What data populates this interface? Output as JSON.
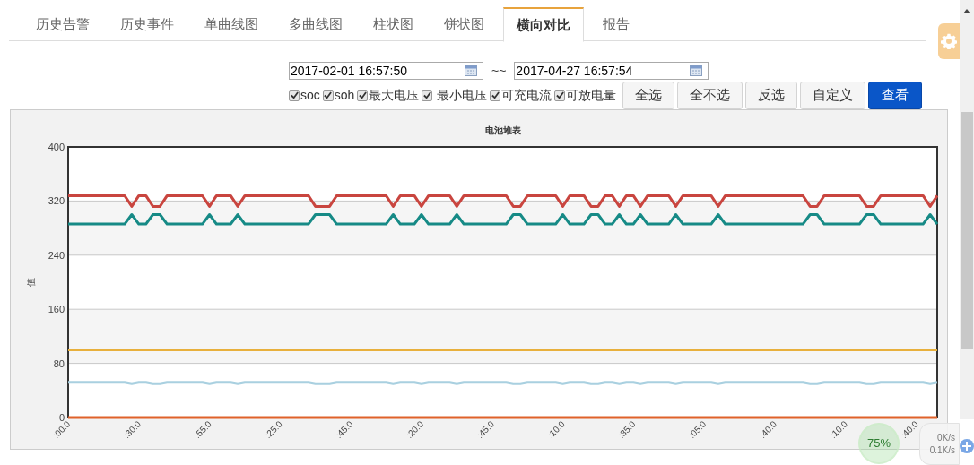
{
  "tabs": [
    {
      "label": "历史告警",
      "selected": false
    },
    {
      "label": "历史事件",
      "selected": false
    },
    {
      "label": "单曲线图",
      "selected": false
    },
    {
      "label": "多曲线图",
      "selected": false
    },
    {
      "label": "柱状图",
      "selected": false
    },
    {
      "label": "饼状图",
      "selected": false
    },
    {
      "label": "横向对比",
      "selected": true
    },
    {
      "label": "报告",
      "selected": false
    }
  ],
  "date_range": {
    "start": "2017-02-01 16:57:50",
    "separator": "~~",
    "end": "2017-04-27 16:57:54"
  },
  "filters": [
    {
      "label": "soc",
      "checked": true
    },
    {
      "label": "soh",
      "checked": true
    },
    {
      "label": "最大电压",
      "checked": true
    },
    {
      "label": "最小电压",
      "checked": true
    },
    {
      "label": "可充电流",
      "checked": true
    },
    {
      "label": "可放电量",
      "checked": true
    }
  ],
  "buttons": [
    {
      "label": "全选",
      "kind": "default"
    },
    {
      "label": "全不选",
      "kind": "default"
    },
    {
      "label": "反选",
      "kind": "default"
    },
    {
      "label": "自定义",
      "kind": "default"
    },
    {
      "label": "查看",
      "kind": "primary"
    }
  ],
  "chart": {
    "chart_data": {
      "type": "line",
      "title": "电池堆表",
      "ylabel": "值",
      "categories": [
        ":00:0",
        null,
        null,
        null,
        null,
        null,
        null,
        null,
        null,
        null,
        ":30:0",
        null,
        null,
        null,
        null,
        null,
        null,
        null,
        null,
        null,
        ":55:0",
        null,
        null,
        null,
        null,
        null,
        null,
        null,
        null,
        null,
        ":25:0",
        null,
        null,
        null,
        null,
        null,
        null,
        null,
        null,
        null,
        ":45:0",
        null,
        null,
        null,
        null,
        null,
        null,
        null,
        null,
        null,
        ":20:0",
        null,
        null,
        null,
        null,
        null,
        null,
        null,
        null,
        null,
        ":45:0",
        null,
        null,
        null,
        null,
        null,
        null,
        null,
        null,
        null,
        ":10:0",
        null,
        null,
        null,
        null,
        null,
        null,
        null,
        null,
        null,
        ":35:0",
        null,
        null,
        null,
        null,
        null,
        null,
        null,
        null,
        null,
        ":05:0",
        null,
        null,
        null,
        null,
        null,
        null,
        null,
        null,
        null,
        ":40:0",
        null,
        null,
        null,
        null,
        null,
        null,
        null,
        null,
        null,
        ":10:0",
        null,
        null,
        null,
        null,
        null,
        null,
        null,
        null,
        null,
        ":40:0",
        null,
        null,
        null
      ],
      "series": [
        {
          "color": "#c9453f",
          "values": [
            328,
            328,
            328,
            328,
            328,
            328,
            328,
            328,
            328,
            312,
            328,
            328,
            312,
            312,
            328,
            328,
            328,
            328,
            328,
            328,
            312,
            328,
            328,
            328,
            312,
            328,
            328,
            328,
            328,
            328,
            328,
            328,
            328,
            328,
            328,
            312,
            312,
            312,
            328,
            328,
            328,
            328,
            328,
            328,
            328,
            328,
            312,
            328,
            328,
            328,
            312,
            328,
            328,
            328,
            328,
            312,
            328,
            328,
            328,
            328,
            328,
            328,
            328,
            312,
            312,
            328,
            328,
            328,
            328,
            328,
            312,
            328,
            328,
            328,
            312,
            312,
            328,
            328,
            312,
            328,
            328,
            312,
            328,
            328,
            328,
            328,
            312,
            328,
            328,
            328,
            328,
            328,
            312,
            328,
            328,
            328,
            328,
            328,
            328,
            328,
            328,
            328,
            328,
            328,
            328,
            312,
            312,
            328,
            328,
            328,
            328,
            328,
            328,
            312,
            312,
            328,
            328,
            328,
            328,
            328,
            328,
            328,
            312,
            328
          ]
        },
        {
          "color": "#168a86",
          "values": [
            286,
            286,
            286,
            286,
            286,
            286,
            286,
            286,
            286,
            300,
            286,
            286,
            300,
            300,
            286,
            286,
            286,
            286,
            286,
            286,
            300,
            286,
            286,
            286,
            300,
            286,
            286,
            286,
            286,
            286,
            286,
            286,
            286,
            286,
            286,
            300,
            300,
            300,
            286,
            286,
            286,
            286,
            286,
            286,
            286,
            286,
            300,
            286,
            286,
            286,
            300,
            286,
            286,
            286,
            286,
            300,
            286,
            286,
            286,
            286,
            286,
            286,
            286,
            300,
            300,
            286,
            286,
            286,
            286,
            286,
            300,
            286,
            286,
            286,
            300,
            300,
            286,
            286,
            300,
            286,
            286,
            300,
            286,
            286,
            286,
            286,
            300,
            286,
            286,
            286,
            286,
            286,
            300,
            286,
            286,
            286,
            286,
            286,
            286,
            286,
            286,
            286,
            286,
            286,
            286,
            300,
            300,
            286,
            286,
            286,
            286,
            286,
            286,
            300,
            300,
            286,
            286,
            286,
            286,
            286,
            286,
            286,
            300,
            286
          ]
        },
        {
          "color": "#e8b03c",
          "values": [
            100,
            100,
            100,
            100,
            100,
            100,
            100,
            100,
            100,
            100,
            100,
            100,
            100,
            100,
            100,
            100,
            100,
            100,
            100,
            100,
            100,
            100,
            100,
            100,
            100,
            100,
            100,
            100,
            100,
            100,
            100,
            100,
            100,
            100,
            100,
            100,
            100,
            100,
            100,
            100,
            100,
            100,
            100,
            100,
            100,
            100,
            100,
            100,
            100,
            100,
            100,
            100,
            100,
            100,
            100,
            100,
            100,
            100,
            100,
            100,
            100,
            100,
            100,
            100,
            100,
            100,
            100,
            100,
            100,
            100,
            100,
            100,
            100,
            100,
            100,
            100,
            100,
            100,
            100,
            100,
            100,
            100,
            100,
            100,
            100,
            100,
            100,
            100,
            100,
            100,
            100,
            100,
            100,
            100,
            100,
            100,
            100,
            100,
            100,
            100,
            100,
            100,
            100,
            100,
            100,
            100,
            100,
            100,
            100,
            100,
            100,
            100,
            100,
            100,
            100,
            100,
            100,
            100,
            100,
            100,
            100,
            100,
            100,
            100
          ]
        },
        {
          "color": "#a9d0e0",
          "values": [
            52,
            52,
            52,
            52,
            52,
            52,
            52,
            52,
            52,
            50,
            52,
            52,
            50,
            50,
            52,
            52,
            52,
            52,
            52,
            52,
            50,
            52,
            52,
            52,
            50,
            52,
            52,
            52,
            52,
            52,
            52,
            52,
            52,
            52,
            52,
            50,
            50,
            50,
            52,
            52,
            52,
            52,
            52,
            52,
            52,
            52,
            50,
            52,
            52,
            52,
            50,
            52,
            52,
            52,
            52,
            50,
            52,
            52,
            52,
            52,
            52,
            52,
            52,
            50,
            50,
            52,
            52,
            52,
            52,
            52,
            50,
            52,
            52,
            52,
            50,
            50,
            52,
            52,
            50,
            52,
            52,
            50,
            52,
            52,
            52,
            52,
            50,
            52,
            52,
            52,
            52,
            52,
            50,
            52,
            52,
            52,
            52,
            52,
            52,
            52,
            52,
            52,
            52,
            52,
            52,
            50,
            50,
            52,
            52,
            52,
            52,
            52,
            52,
            50,
            50,
            52,
            52,
            52,
            52,
            52,
            52,
            52,
            50,
            52
          ]
        },
        {
          "color": "#e0622a",
          "values": [
            0,
            0,
            0,
            0,
            0,
            0,
            0,
            0,
            0,
            0,
            0,
            0,
            0,
            0,
            0,
            0,
            0,
            0,
            0,
            0,
            0,
            0,
            0,
            0,
            0,
            0,
            0,
            0,
            0,
            0,
            0,
            0,
            0,
            0,
            0,
            0,
            0,
            0,
            0,
            0,
            0,
            0,
            0,
            0,
            0,
            0,
            0,
            0,
            0,
            0,
            0,
            0,
            0,
            0,
            0,
            0,
            0,
            0,
            0,
            0,
            0,
            0,
            0,
            0,
            0,
            0,
            0,
            0,
            0,
            0,
            0,
            0,
            0,
            0,
            0,
            0,
            0,
            0,
            0,
            0,
            0,
            0,
            0,
            0,
            0,
            0,
            0,
            0,
            0,
            0,
            0,
            0,
            0,
            0,
            0,
            0,
            0,
            0,
            0,
            0,
            0,
            0,
            0,
            0,
            0,
            0,
            0,
            0,
            0,
            0,
            0,
            0,
            0,
            0,
            0,
            0,
            0,
            0,
            0,
            0,
            0,
            0,
            0,
            0
          ]
        }
      ],
      "ylim": [
        0,
        400
      ],
      "yticks": [
        0,
        80,
        160,
        240,
        320,
        400
      ],
      "grid": true
    }
  },
  "net_widget": {
    "percent": "75%",
    "upload": "0K/s",
    "download": "0.1K/s"
  }
}
